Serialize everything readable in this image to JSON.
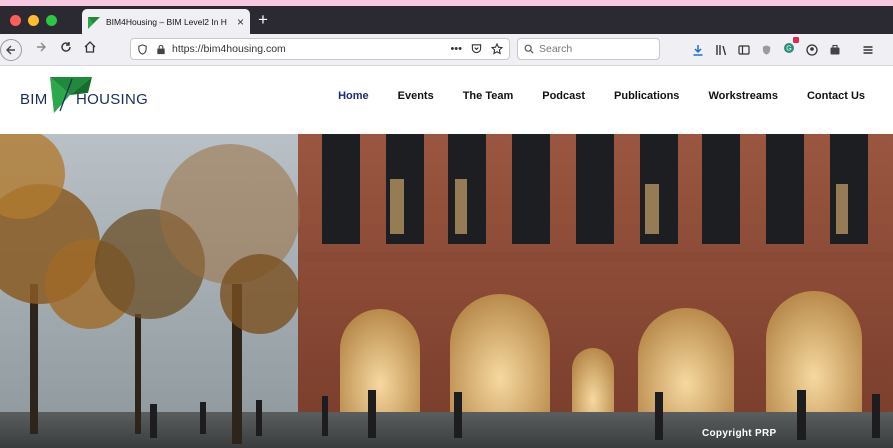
{
  "browser": {
    "tab_title": "BIM4Housing – BIM Level2 In H",
    "tab_close": "×",
    "new_tab": "+",
    "url": "https://bim4housing.com",
    "url_actions": "•••",
    "search_placeholder": "Search"
  },
  "site": {
    "logo": {
      "left": "BIM",
      "right": "HOUSING"
    },
    "nav": [
      {
        "label": "Home",
        "active": true
      },
      {
        "label": "Events"
      },
      {
        "label": "The Team"
      },
      {
        "label": "Podcast"
      },
      {
        "label": "Publications"
      },
      {
        "label": "Workstreams"
      },
      {
        "label": "Contact Us"
      }
    ],
    "hero": {
      "copyright": "Copyright PRP"
    }
  },
  "colors": {
    "brand_navy": "#1a2d5c",
    "brand_green": "#1f8a3c",
    "brick": "#8f4a34"
  },
  "icons": [
    "back-icon",
    "forward-icon",
    "reload-icon",
    "home-icon",
    "shield-icon",
    "lock-icon",
    "pocket-icon",
    "bookmark-star-icon",
    "search-icon",
    "download-icon",
    "library-icon",
    "sidebar-icon",
    "shield-check-icon",
    "extension-icon",
    "account-icon",
    "container-icon",
    "menu-icon"
  ]
}
